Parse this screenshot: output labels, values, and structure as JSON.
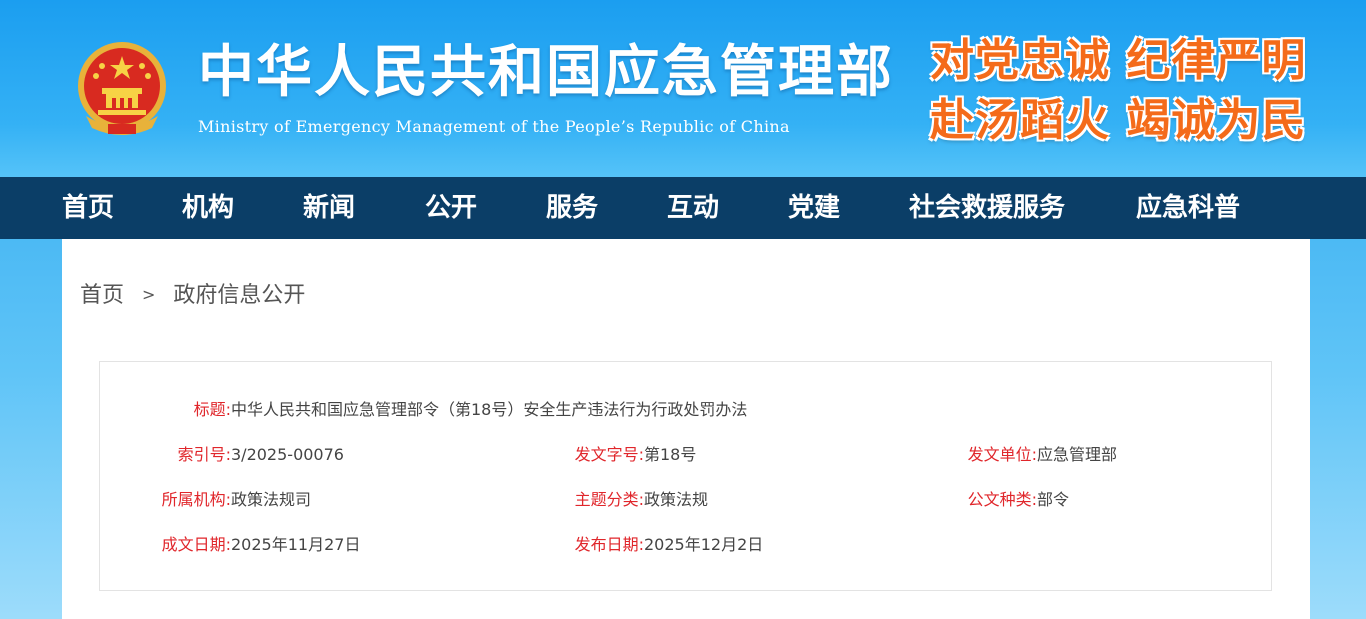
{
  "header": {
    "title": "中华人民共和国应急管理部",
    "subtitle": "Ministry of Emergency Management of the People’s Republic of China",
    "slogan_line1": "对党忠诚 纪律严明",
    "slogan_line2": "赴汤蹈火 竭诚为民",
    "emblem_icon": "national-emblem-icon",
    "colors": {
      "header_blue": "#1b9ef0",
      "slogan_orange": "#f46b1a",
      "nav_dark": "#0b3e67"
    }
  },
  "nav": {
    "items": [
      "首页",
      "机构",
      "新闻",
      "公开",
      "服务",
      "互动",
      "党建",
      "社会救援服务",
      "应急科普"
    ]
  },
  "breadcrumb": {
    "home": "首页",
    "separator": ">",
    "current": "政府信息公开"
  },
  "document": {
    "title_label": "标题:",
    "title_value": "中华人民共和国应急管理部令（第18号）安全生产违法行为行政处罚办法",
    "index_label": "索引号:",
    "index_value": "3/2025-00076",
    "doc_number_label": "发文字号:",
    "doc_number_value": "第18号",
    "issuer_label": "发文单位:",
    "issuer_value": "应急管理部",
    "agency_label": "所属机构:",
    "agency_value": "政策法规司",
    "category_label": "主题分类:",
    "category_value": "政策法规",
    "doc_type_label": "公文种类:",
    "doc_type_value": "部令",
    "created_label": "成文日期:",
    "created_value": "2025年11月27日",
    "published_label": "发布日期:",
    "published_value": "2025年12月2日"
  }
}
